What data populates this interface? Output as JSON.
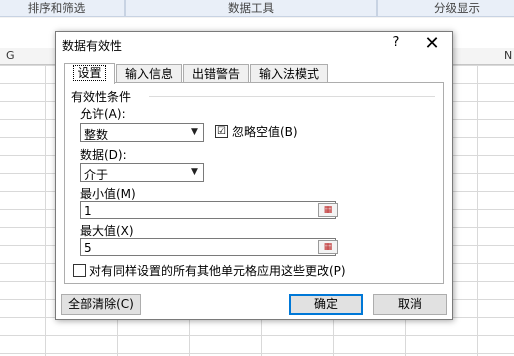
{
  "background": {
    "ribbon_groups": [
      "排序和筛选",
      "数据工具",
      "分级显示"
    ],
    "columns": [
      "G",
      "N"
    ]
  },
  "dialog": {
    "title": "数据有效性",
    "help": "?",
    "close": "✕",
    "tabs": [
      "设置",
      "输入信息",
      "出错警告",
      "输入法模式"
    ],
    "active_tab": "设置",
    "group_title": "有效性条件",
    "allow_label": "允许(A):",
    "allow_value": "整数",
    "ignore_blank_label": "忽略空值(B)",
    "ignore_blank_checked": "☑",
    "data_label": "数据(D):",
    "data_value": "介于",
    "min_label": "最小值(M)",
    "min_value": "1",
    "max_label": "最大值(X)",
    "max_value": "5",
    "apply_all_label": "对有同样设置的所有其他单元格应用这些更改(P)",
    "clear_all_label": "全部清除(C)",
    "ok_label": "确定",
    "cancel_label": "取消"
  }
}
